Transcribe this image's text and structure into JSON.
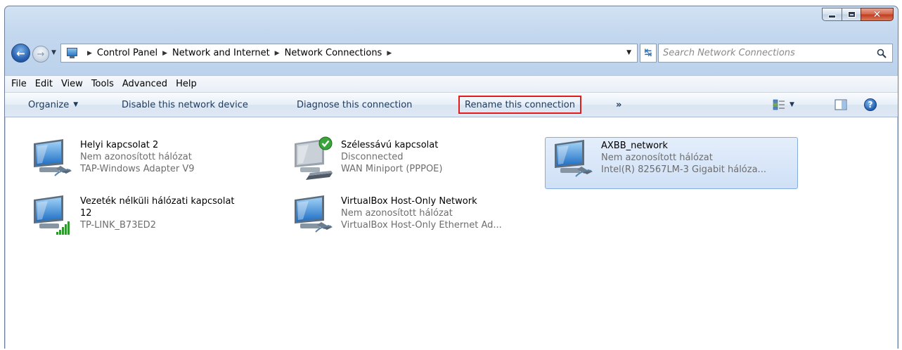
{
  "breadcrumb": [
    "Control Panel",
    "Network and Internet",
    "Network Connections"
  ],
  "search": {
    "placeholder": "Search Network Connections"
  },
  "menu": [
    "File",
    "Edit",
    "View",
    "Tools",
    "Advanced",
    "Help"
  ],
  "commands": {
    "organize": "Organize",
    "disable": "Disable this network device",
    "diagnose": "Diagnose this connection",
    "rename": "Rename this connection",
    "more": "»"
  },
  "highlight_color": "#e21b1b",
  "connections": [
    {
      "name": "Helyi kapcsolat 2",
      "status": "Nem azonosított hálózat",
      "device": "TAP-Windows Adapter V9",
      "icon": "wired-network-icon"
    },
    {
      "name": "Szélessávú kapcsolat",
      "status": "Disconnected",
      "device": "WAN Miniport (PPPOE)",
      "icon": "broadband-network-icon"
    },
    {
      "name": "AXBB_network",
      "status": "Nem azonosított hálózat",
      "device": "Intel(R) 82567LM-3 Gigabit hálóza...",
      "icon": "wired-network-icon",
      "selected": true
    },
    {
      "name": "Vezeték nélküli hálózati kapcsolat",
      "name_line2": "12",
      "device": "TP-LINK_B73ED2",
      "icon": "wireless-network-icon"
    },
    {
      "name": "VirtualBox Host-Only Network",
      "status": "Nem azonosított hálózat",
      "device": "VirtualBox Host-Only Ethernet Ad...",
      "icon": "wired-network-icon"
    }
  ]
}
